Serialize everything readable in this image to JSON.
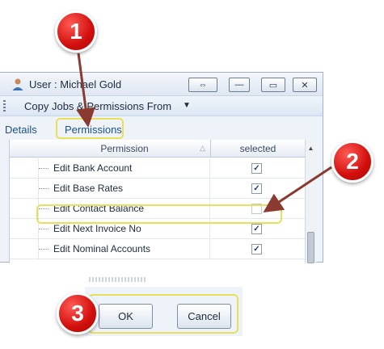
{
  "window": {
    "title": "User : Michael Gold",
    "controls": [
      "⇔",
      "—",
      "▭",
      "✕"
    ]
  },
  "menubar": {
    "copy_label": "Copy Jobs & Permissions From"
  },
  "tabs": [
    {
      "label": "Details"
    },
    {
      "label": "Permissions"
    }
  ],
  "grid": {
    "columns": [
      "Permission",
      "selected"
    ],
    "rows": [
      {
        "label": "Edit Bank Account",
        "selected": true
      },
      {
        "label": "Edit Base Rates",
        "selected": true
      },
      {
        "label": "Edit Contact Balance",
        "selected": false
      },
      {
        "label": "Edit Next Invoice No",
        "selected": true
      },
      {
        "label": "Edit Nominal Accounts",
        "selected": true
      }
    ]
  },
  "buttons": {
    "ok": "OK",
    "cancel": "Cancel"
  },
  "callouts": [
    "1",
    "2",
    "3"
  ],
  "colors": {
    "callout": "#d10f0c",
    "highlight": "#e8e05a",
    "arrow": "#8a3a2e"
  }
}
